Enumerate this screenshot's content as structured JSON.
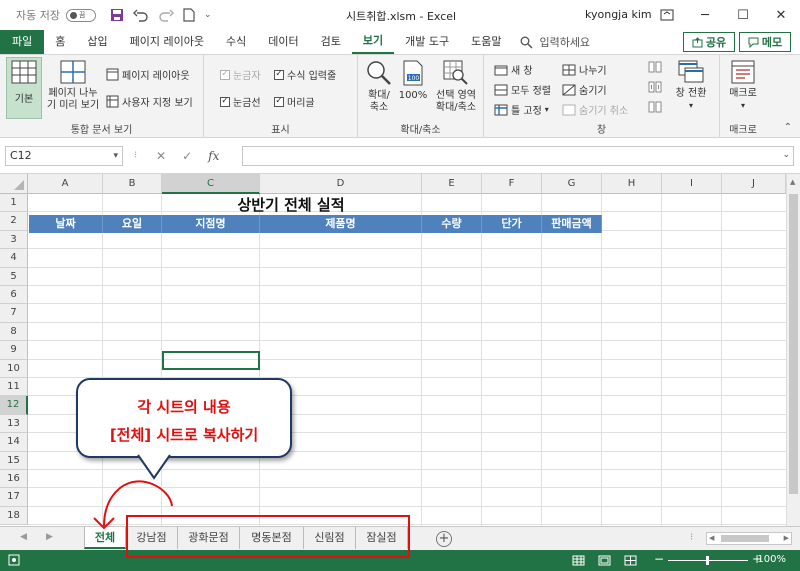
{
  "titlebar": {
    "autosave_label": "자동 저장",
    "autosave_state": "끔",
    "filename": "시트취합.xlsm  -  Excel",
    "user": "kyongja kim"
  },
  "tabs": [
    "파일",
    "홈",
    "삽입",
    "페이지 레이아웃",
    "수식",
    "데이터",
    "검토",
    "보기",
    "개발 도구",
    "도움말"
  ],
  "active_tab": "보기",
  "search_placeholder": "입력하세요",
  "share_label": "공유",
  "memo_label": "메모",
  "ribbon": {
    "views": {
      "label": "통합 문서 보기",
      "basic": "기본",
      "page_break_line1": "페이지 나누",
      "page_break_line2": "기 미리 보기",
      "page_layout": "페이지 레이아웃",
      "custom_views": "사용자 지정 보기"
    },
    "show": {
      "label": "표시",
      "ruler": "눈금자",
      "formula_bar": "수식 입력줄",
      "gridlines": "눈금선",
      "headings": "머리글"
    },
    "zoom": {
      "label": "확대/축소",
      "zoom_line1": "확대/",
      "zoom_line2": "축소",
      "hundred": "100%",
      "sel_line1": "선택 영역",
      "sel_line2": "확대/축소"
    },
    "window": {
      "label": "창",
      "new_window": "새 창",
      "arrange_all": "모두 정렬",
      "freeze": "틀 고정",
      "split": "나누기",
      "hide": "숨기기",
      "unhide": "숨기기 취소",
      "switch_line1": "창 전환"
    },
    "macro": {
      "label": "매크로",
      "macro_btn": "매크로"
    }
  },
  "formula_bar": {
    "name_box": "C12",
    "fx": "fx",
    "formula": ""
  },
  "columns": [
    "A",
    "B",
    "C",
    "D",
    "E",
    "F",
    "G",
    "H",
    "I",
    "J"
  ],
  "selected_column": "C",
  "rows": [
    "1",
    "2",
    "3",
    "4",
    "5",
    "6",
    "7",
    "8",
    "9",
    "10",
    "11",
    "12",
    "13",
    "14",
    "15",
    "16",
    "17",
    "18"
  ],
  "selected_row": "12",
  "sheet": {
    "title": "상반기 전체 실적",
    "headers": [
      "날짜",
      "요일",
      "지점명",
      "제품명",
      "수량",
      "단가",
      "판매금액"
    ],
    "header_color": "#4f81bd"
  },
  "sheet_tabs": [
    "전체",
    "강남점",
    "광화문점",
    "명동본점",
    "신림점",
    "잠실점"
  ],
  "active_sheet": "전체",
  "status": {
    "zoom": "100%"
  },
  "callout": {
    "line1": "각 시트의 내용",
    "line2": "[전체] 시트로 복사하기",
    "text_color": "#e01010"
  },
  "accent_color": "#217346"
}
